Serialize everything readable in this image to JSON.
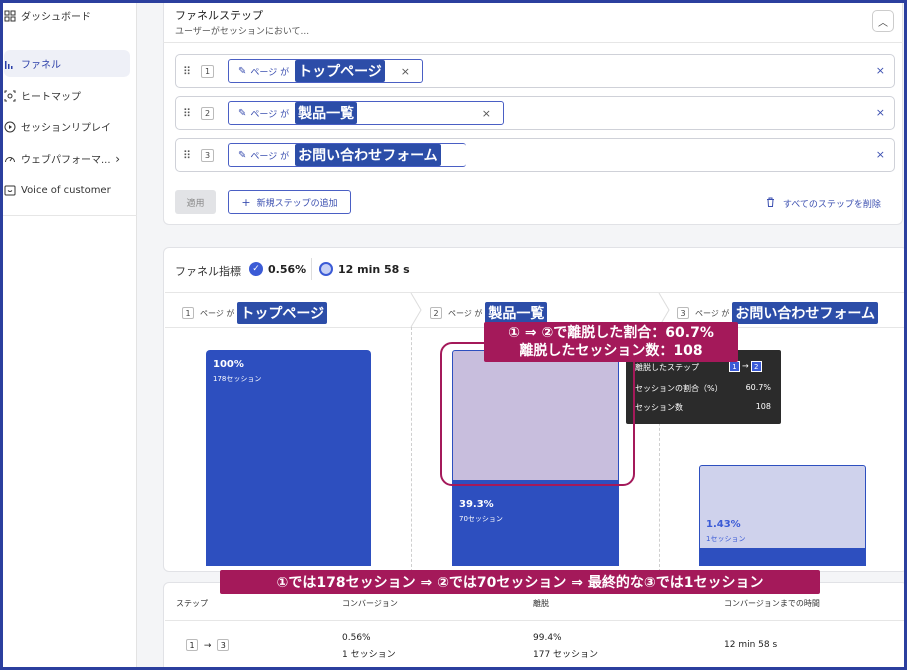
{
  "sidebar": {
    "items": [
      {
        "label": "ダッシュボード",
        "icon": "grid-icon"
      },
      {
        "label": "ファネル",
        "icon": "funnel-bars-icon",
        "active": true
      },
      {
        "label": "ヒートマップ",
        "icon": "heatmap-icon"
      },
      {
        "label": "セッションリプレイ",
        "icon": "play-circle-icon"
      },
      {
        "label": "ウェブパフォーマ...",
        "icon": "gauge-icon",
        "has_chevron": true
      },
      {
        "label": "Voice of customer",
        "icon": "feedback-icon"
      }
    ]
  },
  "steps_panel": {
    "title": "ファネルステップ",
    "subtitle": "ユーザーがセッションにおいて...",
    "steps": [
      {
        "number": "1",
        "condition": "ページ が",
        "value": "トップページ"
      },
      {
        "number": "2",
        "condition": "ページ が",
        "value": "製品一覧"
      },
      {
        "number": "3",
        "condition": "ページ が",
        "value": "お問い合わせフォーム"
      }
    ],
    "apply_label": "適用",
    "add_step_label": "新規ステップの追加",
    "delete_all_label": "すべてのステップを削除"
  },
  "funnel_metrics": {
    "title": "ファネル指標",
    "conversion": "0.56%",
    "time": "12 min 58 s"
  },
  "chart_data": {
    "type": "bar",
    "categories": [
      "トップページ",
      "製品一覧",
      "お問い合わせフォーム"
    ],
    "step_numbers": [
      "1",
      "2",
      "3"
    ],
    "condition_label": "ページ が",
    "values": [
      100,
      39.3,
      1.43
    ],
    "value_labels": [
      "100%",
      "39.3%",
      "1.43%"
    ],
    "sessions": [
      178,
      70,
      1
    ],
    "session_labels": [
      "178セッション",
      "70セッション",
      "1セッション"
    ],
    "ylim": [
      0,
      100
    ],
    "colors": {
      "bar": "#2d4fbf",
      "dropoff": "#cfd2ec",
      "dropoff_highlight": "#c8bedd"
    }
  },
  "tooltip": {
    "title": "離脱したステップ",
    "from": "1",
    "to": "2",
    "rate_label": "セッションの割合（%）",
    "rate_value": "60.7%",
    "count_label": "セッション数",
    "count_value": "108"
  },
  "annotations": {
    "dropoff_line1": "① ⇒ ②で離脱した割合：60.7%",
    "dropoff_line2": "離脱したセッション数：108",
    "summary": "①では178セッション ⇒ ②では70セッション ⇒ 最終的な③では1セッション",
    "color": "#a4195a"
  },
  "table": {
    "headers": [
      "ステップ",
      "コンバージョン",
      "離脱",
      "コンバージョンまでの時間"
    ],
    "rows": [
      {
        "from": "1",
        "to": "3",
        "conversion": "0.56%",
        "conversion_sessions": "1 セッション",
        "dropoff": "99.4%",
        "dropoff_sessions": "177 セッション",
        "time": "12 min 58 s"
      }
    ]
  }
}
